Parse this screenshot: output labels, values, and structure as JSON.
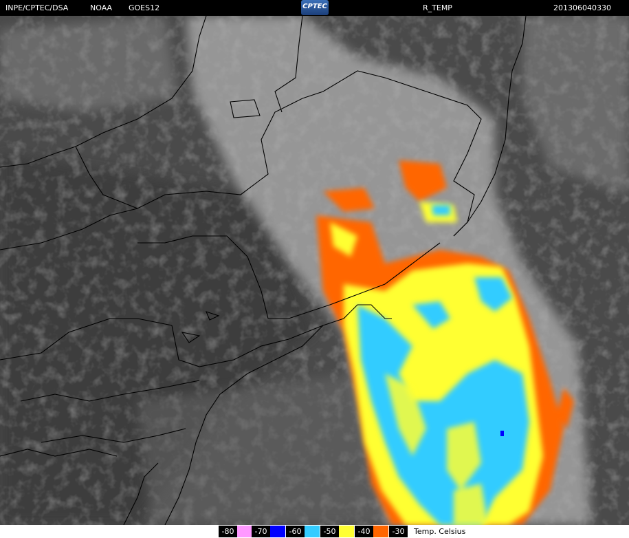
{
  "header": {
    "source": "INPE/CPTEC/DSA",
    "agency": "NOAA",
    "satellite": "GOES12",
    "logo_text": "CPTEC",
    "product": "R_TEMP",
    "timestamp": "201306040330"
  },
  "legend": {
    "title": "Temp. Celsius",
    "items": [
      {
        "label": "-80",
        "color": "#ff99ff"
      },
      {
        "label": "-70",
        "color": "#0000ff"
      },
      {
        "label": "-60",
        "color": "#33ccff"
      },
      {
        "label": "-50",
        "color": "#ffff33"
      },
      {
        "label": "-40",
        "color": "#ff6600"
      },
      {
        "label": "-30",
        "color": "#000000"
      }
    ]
  },
  "colors": {
    "background_gray": "#4a4a4a",
    "cloud_light": "#b8b8b8",
    "boundary_line": "#000000"
  }
}
